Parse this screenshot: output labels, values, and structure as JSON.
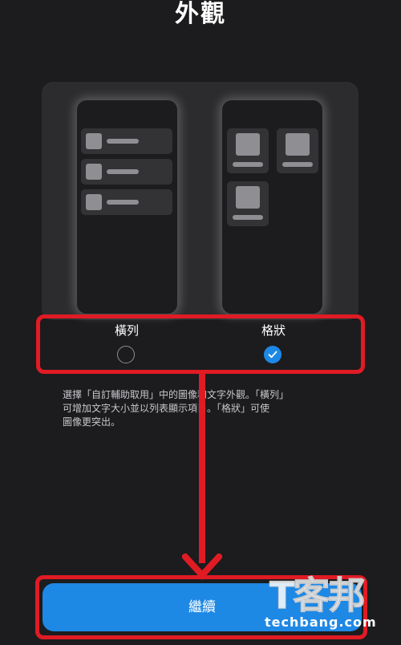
{
  "header": {
    "title": "外觀"
  },
  "appearance_options": [
    {
      "label": "橫列",
      "selected": false
    },
    {
      "label": "格狀",
      "selected": true
    }
  ],
  "description": {
    "line1": "選擇「自訂輔助取用」中的圖像和文字外觀。「橫列」",
    "line2": "可增加文字大小並以列表顯示項目。「格狀」可使",
    "line3": "圖像更突出。"
  },
  "footer": {
    "continue_label": "繼續"
  },
  "watermark": {
    "chinese": "T客邦",
    "english": "techbang.com"
  },
  "colors": {
    "background": "#1c1c1e",
    "accent": "#1e88e5",
    "highlight": "#e01b24"
  }
}
